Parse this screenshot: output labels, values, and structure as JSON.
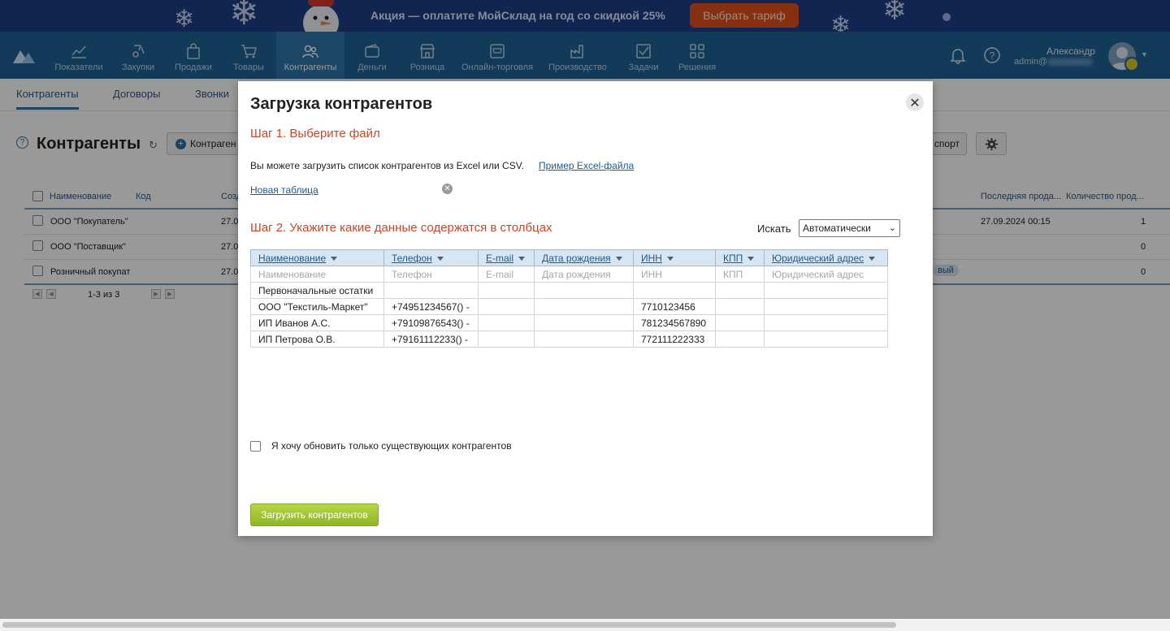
{
  "promo": {
    "text": "Акция — оплатите МойСклад на год со скидкой 25%",
    "button": "Выбрать тариф"
  },
  "nav": {
    "items": [
      {
        "label": "Показатели",
        "icon": "chart-line-icon"
      },
      {
        "label": "Закупки",
        "icon": "purchases-icon"
      },
      {
        "label": "Продажи",
        "icon": "shopping-bag-icon"
      },
      {
        "label": "Товары",
        "icon": "cart-icon"
      },
      {
        "label": "Контрагенты",
        "icon": "people-icon",
        "active": true
      },
      {
        "label": "Деньги",
        "icon": "wallet-icon"
      },
      {
        "label": "Розница",
        "icon": "store-icon"
      },
      {
        "label": "Онлайн-торговля",
        "icon": "online-store-icon"
      },
      {
        "label": "Производство",
        "icon": "factory-icon"
      },
      {
        "label": "Задачи",
        "icon": "task-check-icon"
      },
      {
        "label": "Решения",
        "icon": "apps-grid-icon"
      }
    ],
    "user_name": "Александр",
    "user_email_prefix": "admin@"
  },
  "subnav": {
    "tabs": [
      "Контрагенты",
      "Договоры",
      "Звонки"
    ]
  },
  "page": {
    "title": "Контрагенты",
    "add_button": "Контраген",
    "export_button": "спорт",
    "columns": {
      "name": "Наименование",
      "code": "Код",
      "created": "Созд",
      "last_sale": "Последняя прода...",
      "sales_count": "Количество прод..."
    },
    "rows": [
      {
        "name": "ООО \"Покупатель\"",
        "created": "27.0",
        "last_sale": "27.09.2024 00:15",
        "count": "1"
      },
      {
        "name": "ООО \"Поставщик\"",
        "created": "27.0",
        "last_sale": "",
        "count": "0"
      },
      {
        "name": "Розничный покупат",
        "created": "27.0",
        "last_sale": "",
        "count": "0"
      }
    ],
    "tag": "вый",
    "pager": "1-3 из 3"
  },
  "modal": {
    "title": "Загрузка контрагентов",
    "step1": "Шаг 1. Выберите файл",
    "hint": "Вы можете загрузить список контрагентов из Excel или CSV.",
    "excel_link": "Пример Excel-файла",
    "file_name": "Новая таблица",
    "step2": "Шаг 2. Укажите какие данные содержатся в столбцах",
    "search_label": "Искать",
    "search_value": "Автоматически",
    "table": {
      "headers": [
        "Наименование",
        "Телефон",
        "E-mail",
        "Дата рождения",
        "ИНН",
        "КПП",
        "Юридический адрес"
      ],
      "placeholders": [
        "Наименование",
        "Телефон",
        "E-mail",
        "Дата рождения",
        "ИНН",
        "КПП",
        "Юридический адрес"
      ],
      "rows": [
        [
          "Первоначальные остатки",
          "",
          "",
          "",
          "",
          "",
          ""
        ],
        [
          "ООО \"Текстиль-Маркет\"",
          "+74951234567() -",
          "",
          "",
          "7710123456",
          "",
          ""
        ],
        [
          "ИП Иванов А.С.",
          "+79109876543() -",
          "",
          "",
          "781234567890",
          "",
          ""
        ],
        [
          "ИП Петрова О.В.",
          "+79161112233() -",
          "",
          "",
          "772111222333",
          "",
          ""
        ]
      ]
    },
    "update_only_label": "Я хочу обновить только существующих контрагентов",
    "upload_button": "Загрузить контрагентов"
  }
}
